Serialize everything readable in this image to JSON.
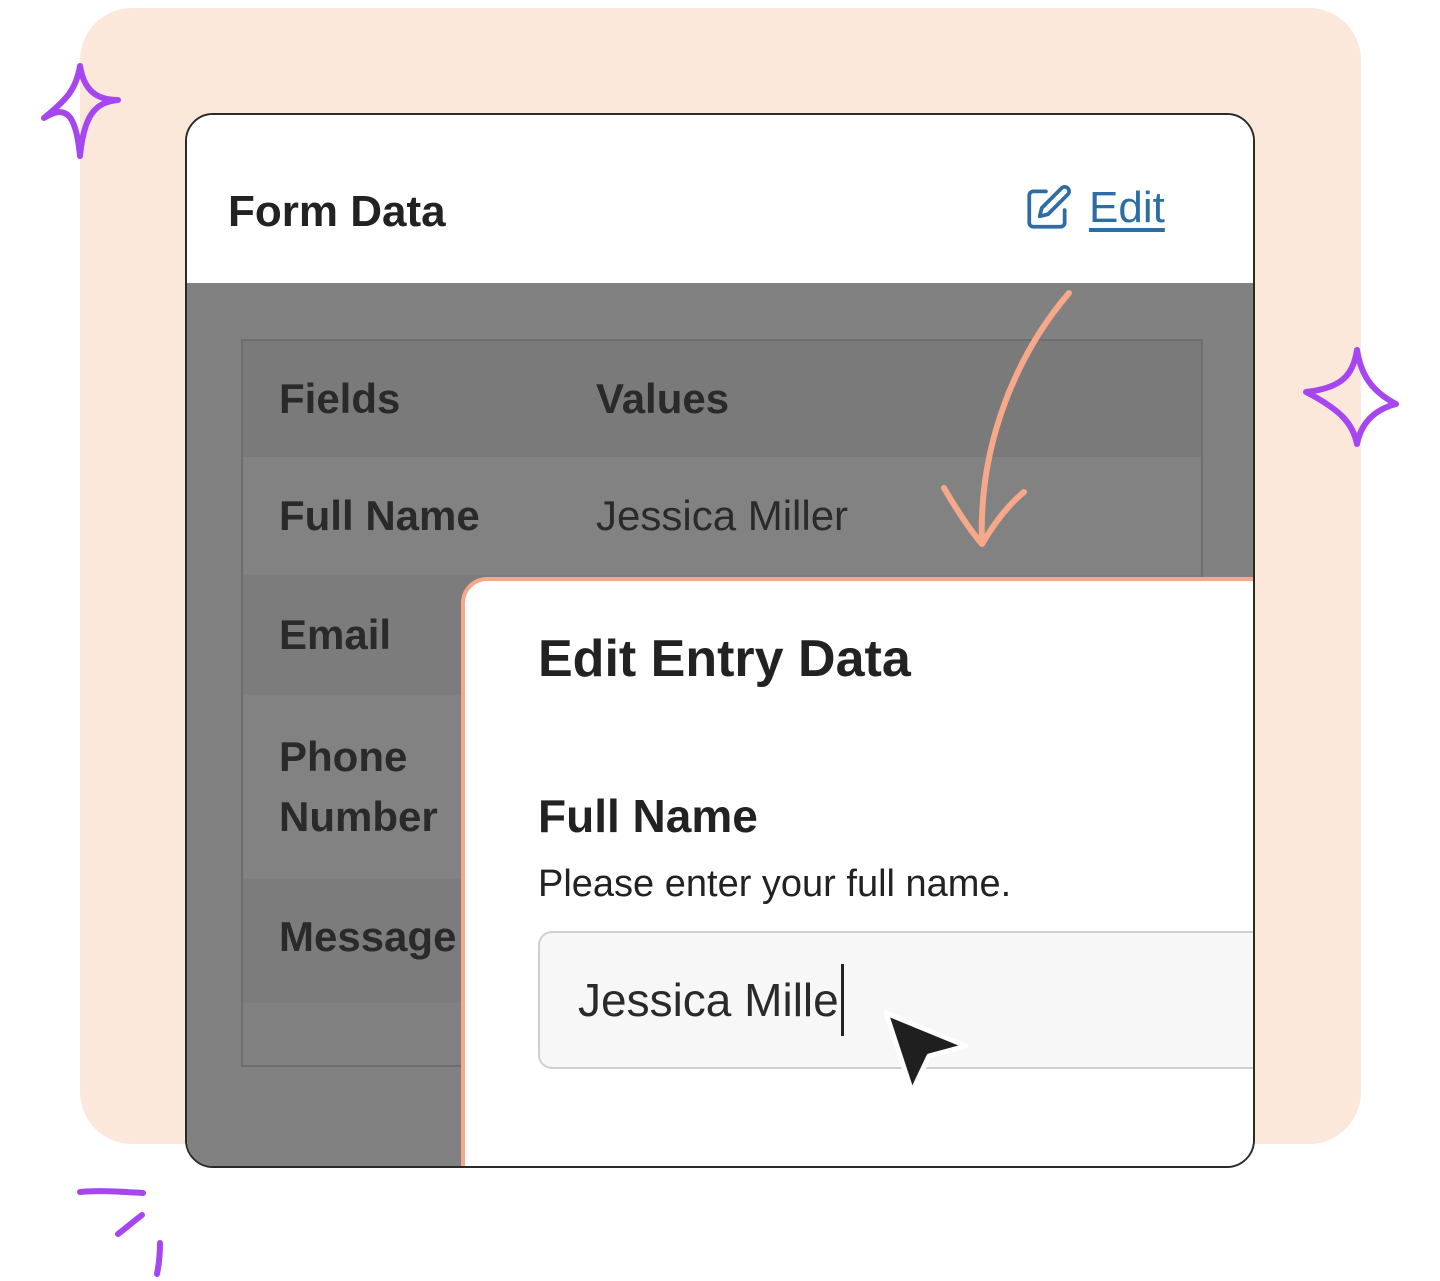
{
  "card": {
    "title": "Form Data",
    "edit_label": "Edit"
  },
  "table": {
    "headers": [
      "Fields",
      "Values"
    ],
    "rows": [
      {
        "field": "Full Name",
        "value": "Jessica Miller"
      },
      {
        "field": "Email",
        "value": ""
      },
      {
        "field": "Phone Number",
        "value": ""
      },
      {
        "field": "Message",
        "value": ""
      }
    ]
  },
  "modal": {
    "title": "Edit Entry Data",
    "field_label": "Full Name",
    "field_help": "Please enter your full name.",
    "input_value": "Jessica Mille"
  },
  "colors": {
    "backdrop": "#fbe8da",
    "sparkle": "#a646f0",
    "arrow": "#f6a88a",
    "link": "#2e6da4",
    "modal_border": "#f5a98a"
  },
  "icons": [
    "sparkle-icon",
    "edit-pencil-icon",
    "curved-arrow-icon",
    "mouse-pointer-icon"
  ]
}
